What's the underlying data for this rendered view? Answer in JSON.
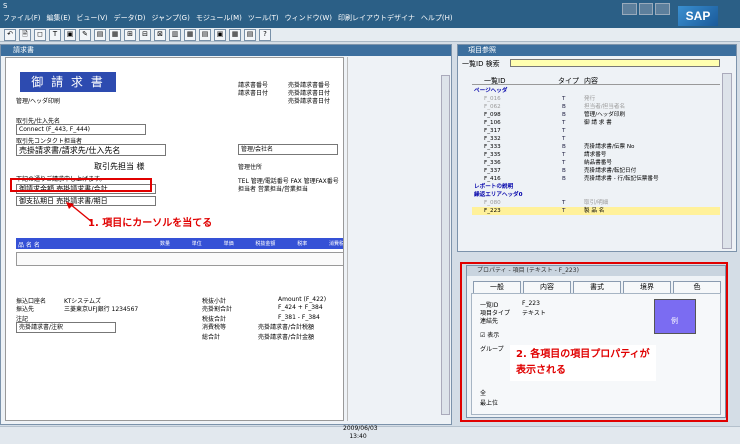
{
  "window": {
    "app_icon": "S",
    "menu": [
      "ファイル(F)",
      "編集(E)",
      "ビュー(V)",
      "データ(D)",
      "ジャンプ(G)",
      "モジュール(M)",
      "ツール(T)",
      "ウィンドウ(W)",
      "印刷レイアウトデザイナ",
      "ヘルプ(H)"
    ],
    "logo": "SAP"
  },
  "toolbar": {
    "icons": [
      "↶",
      "🗎",
      "◻",
      "T",
      "▣",
      "✎",
      "▤",
      "▦",
      "⊞",
      "⊟",
      "⊠",
      "▥",
      "▦",
      "▤",
      "▣",
      "▦",
      "▤",
      "?"
    ]
  },
  "left_window": {
    "title": "請求書",
    "invoice_title": "御 請 求 書",
    "header_fields": {
      "invoice_no_label": "請求書番号",
      "invoice_no_value": "売掛請求書番号",
      "date_label": "請求書日付",
      "date_value": "売掛請求書日付",
      "due_date_value": "売掛請求書日付"
    },
    "bp_section_label": "取引先/仕入先名",
    "customer_value": "Connect (F_443, F_444)",
    "contact_label": "取引先コンタクト担当者",
    "bill_to_label": "売掛請求書/請求先/仕入先名",
    "customer_honorific": "取引先担当 様",
    "manager_label": "管理/会社名",
    "address_label": "管理住所",
    "tel_line": "TEL 管理/電話番号 FAX 管理FAX番号",
    "rep_line": "担当者   営業担当/営業担当",
    "info_line": "下記の通りご請求申し上げます。",
    "total_label": "御請求金額",
    "total_value": "売掛請求書/合計",
    "remark_label": "御支払期日",
    "remark_value": "売掛請求書/期日",
    "table_header_left": "品 名 名",
    "table_header_cols": [
      "数量",
      "単位",
      "単価",
      "税抜金額",
      "税率",
      "消費税"
    ],
    "bank_label": "振込口座名",
    "bank_value": "KTシステムズ",
    "bank_account_label": "振込先",
    "bank_account_value": "三菱東京UFJ銀行 1234567",
    "notes_label": "注記",
    "notes_value": "売掛請求書/注釈",
    "subtotal_label": "税抜小計",
    "subtotal_value": "Amount (F_422)",
    "discount_label": "売掛割合計",
    "discount_value": "F_424 + F_384",
    "tax_label": "税抜合計",
    "tax_value": "F_381 - F_384",
    "vat_label": "消費税等",
    "vat_value": "売掛請求書/合計税額",
    "grand_total_label": "総合計",
    "grand_total_value": "売掛請求書/合計金額"
  },
  "right_top_window": {
    "title": "項目参照",
    "search_label": "一覧ID 検索",
    "col_headers": [
      "一覧ID",
      "タイプ",
      "内容"
    ],
    "groups": {
      "page_header": "ページヘッダ",
      "report_header": "レポートの説明",
      "repeat_area": "繰返エリアヘッダ0"
    },
    "rows": [
      {
        "id": "F_016",
        "type": "T",
        "content": "発行",
        "dim": true
      },
      {
        "id": "F_062",
        "type": "B",
        "content": "担当者/担当者名",
        "dim": true
      },
      {
        "id": "F_098",
        "type": "B",
        "content": "管理/ヘッダ印刷",
        "dim": false
      },
      {
        "id": "F_106",
        "type": "T",
        "content": "御 請 求 書",
        "dim": false
      },
      {
        "id": "F_317",
        "type": "T",
        "content": "",
        "dim": false
      },
      {
        "id": "F_332",
        "type": "T",
        "content": "",
        "dim": false
      },
      {
        "id": "F_333",
        "type": "B",
        "content": "売掛請求書/伝票 No",
        "dim": false
      },
      {
        "id": "F_335",
        "type": "T",
        "content": "請求番号",
        "dim": false
      },
      {
        "id": "F_336",
        "type": "T",
        "content": "納品書番号",
        "dim": false
      },
      {
        "id": "F_337",
        "type": "B",
        "content": "売掛請求書/転記日付",
        "dim": false
      },
      {
        "id": "F_416",
        "type": "B",
        "content": "売掛請求書 - 行/転記伝票番号",
        "dim": false
      },
      {
        "id": "F_080",
        "type": "T",
        "content": "取引/明細",
        "dim": true
      },
      {
        "id": "F_223",
        "type": "T",
        "content": "製 品 名",
        "dim": false
      }
    ]
  },
  "right_bottom_window": {
    "title": "プロパティ - 項目 (テキスト - F_223)",
    "tabs": [
      "一般",
      "内容",
      "書式",
      "境界",
      "色"
    ],
    "fields": [
      {
        "label": "一覧ID",
        "value": "F_223"
      },
      {
        "label": "項目タイプ",
        "value": "テキスト"
      },
      {
        "label": "連結先",
        "value": ""
      }
    ],
    "checkbox_label": "表示",
    "group_label": "グループ",
    "extra_labels": [
      "全",
      "最上位"
    ],
    "preview_label": "例"
  },
  "annotations": {
    "step1": "1. 項目にカーソルを当てる",
    "step2_line1": "2. 各項目の項目プロパティが",
    "step2_line2": "表示される"
  },
  "status": {
    "date": "2009/06/03",
    "time": "13:40"
  },
  "colors": {
    "accent": "#2d4bb0",
    "highlight": "#3551d6",
    "annotation": "#e00000",
    "selected_row": "#fff19a"
  }
}
